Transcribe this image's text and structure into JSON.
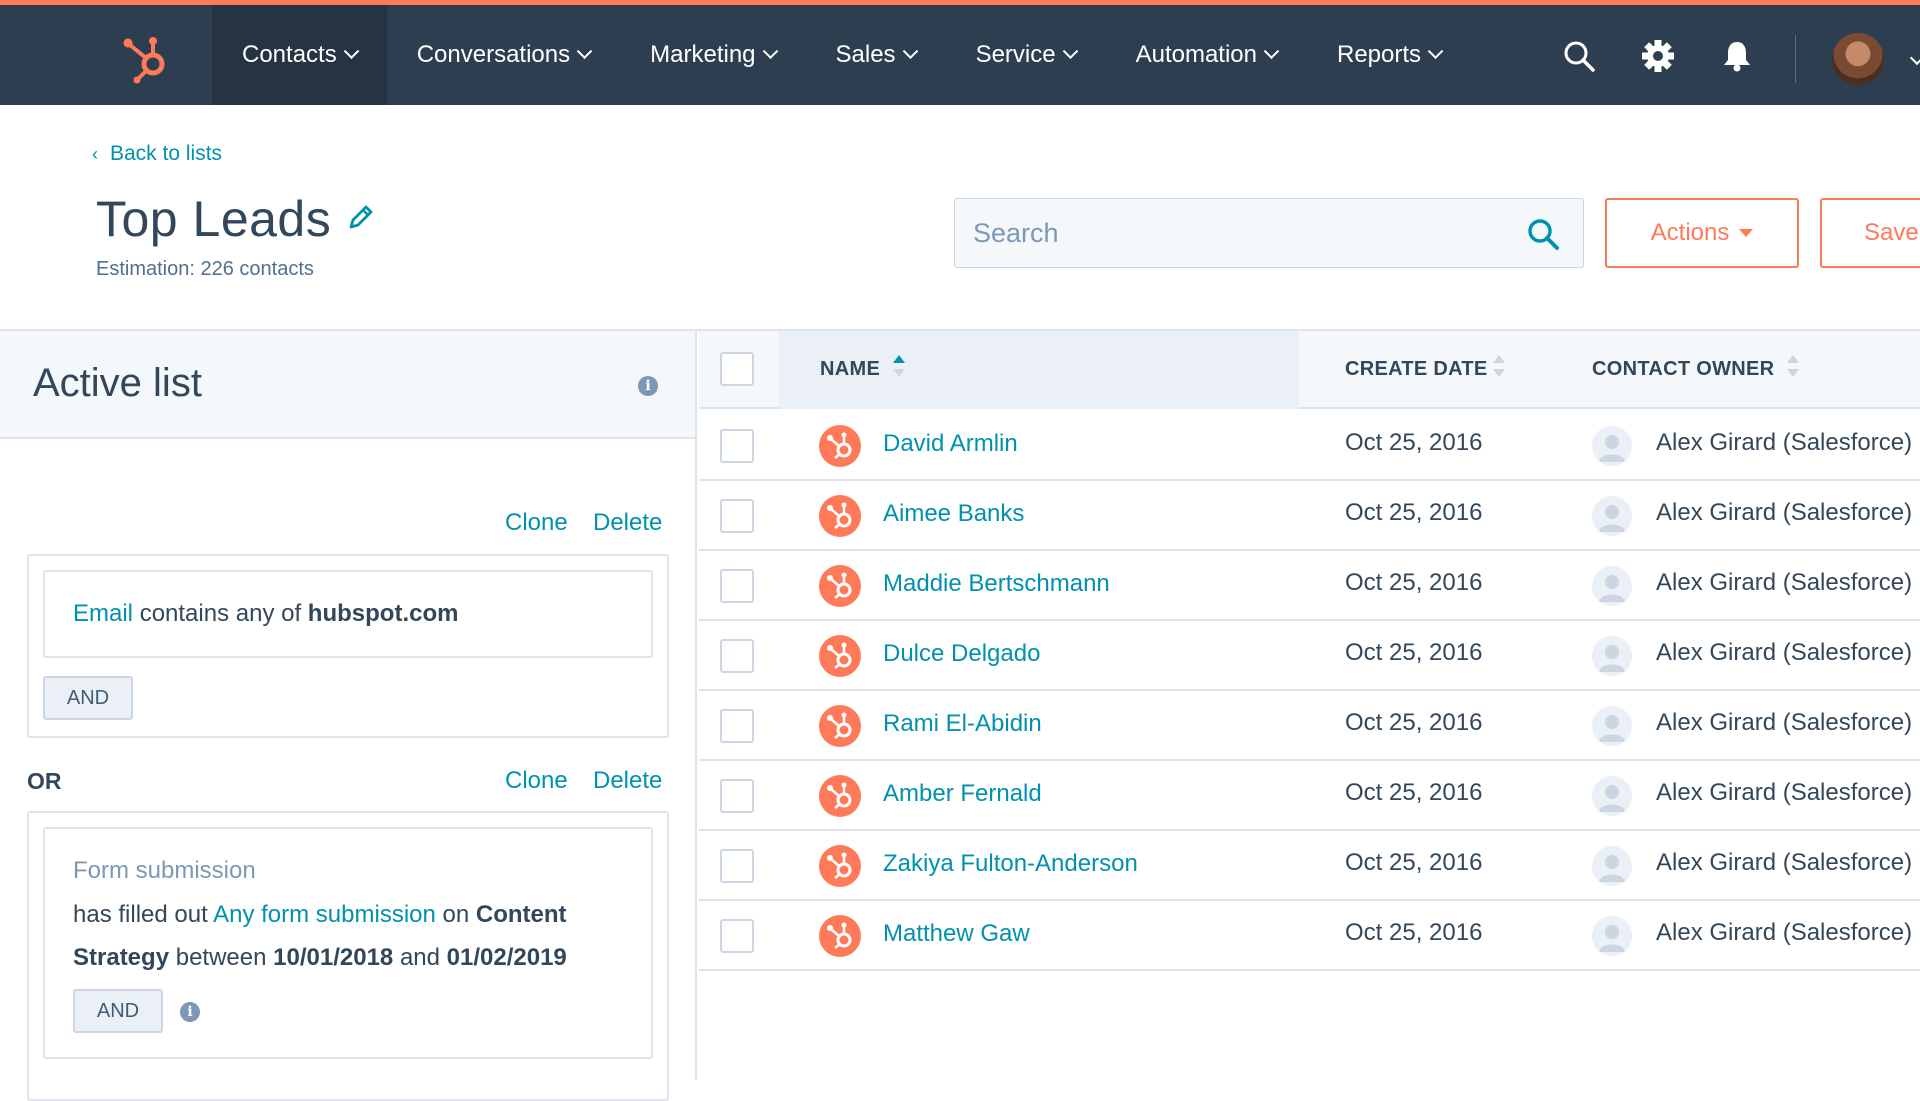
{
  "nav": {
    "items": [
      {
        "label": "Contacts",
        "active": true
      },
      {
        "label": "Conversations",
        "active": false
      },
      {
        "label": "Marketing",
        "active": false
      },
      {
        "label": "Sales",
        "active": false
      },
      {
        "label": "Service",
        "active": false
      },
      {
        "label": "Automation",
        "active": false
      },
      {
        "label": "Reports",
        "active": false
      }
    ],
    "icons": [
      "search-icon",
      "gear-icon",
      "bell-icon",
      "avatar"
    ]
  },
  "header": {
    "back_label": "Back to lists",
    "title": "Top Leads",
    "estimation": "Estimation: 226 contacts",
    "search_placeholder": "Search",
    "actions_label": "Actions",
    "save_label": "Save"
  },
  "filters": {
    "panel_title": "Active list",
    "clone_label": "Clone",
    "delete_label": "Delete",
    "or_label": "OR",
    "and_label": "AND",
    "group1": {
      "property": "Email",
      "operator": "contains any of",
      "value": "hubspot.com"
    },
    "group2": {
      "heading": "Form submission",
      "prefix": "has filled out",
      "form": "Any form submission",
      "on_label": "on",
      "page_line1": "Content",
      "page_line2": "Strategy",
      "between_label": "between",
      "start": "10/01/2018",
      "and_word": "and",
      "end": "01/02/2019"
    }
  },
  "table": {
    "columns": [
      "NAME",
      "CREATE DATE",
      "CONTACT OWNER"
    ],
    "rows": [
      {
        "name": "David Armlin",
        "date": "Oct 25, 2016",
        "owner": "Alex Girard (Salesforce)"
      },
      {
        "name": "Aimee Banks",
        "date": "Oct 25, 2016",
        "owner": "Alex Girard (Salesforce)"
      },
      {
        "name": "Maddie Bertschmann",
        "date": "Oct 25, 2016",
        "owner": "Alex Girard (Salesforce)"
      },
      {
        "name": "Dulce Delgado",
        "date": "Oct 25, 2016",
        "owner": "Alex Girard (Salesforce)"
      },
      {
        "name": "Rami El-Abidin",
        "date": "Oct 25, 2016",
        "owner": "Alex Girard (Salesforce)"
      },
      {
        "name": "Amber Fernald",
        "date": "Oct 25, 2016",
        "owner": "Alex Girard (Salesforce)"
      },
      {
        "name": "Zakiya Fulton-Anderson",
        "date": "Oct 25, 2016",
        "owner": "Alex Girard (Salesforce)"
      },
      {
        "name": "Matthew Gaw",
        "date": "Oct 25, 2016",
        "owner": "Alex Girard (Salesforce)"
      }
    ]
  },
  "colors": {
    "nav_bg": "#2d3e50",
    "accent": "#ff7a59",
    "link": "#0091ae",
    "text": "#33475b"
  }
}
